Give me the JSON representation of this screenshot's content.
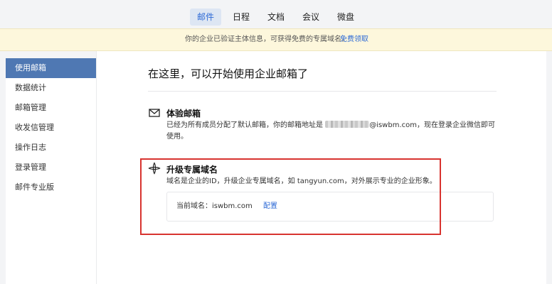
{
  "nav": {
    "tabs": [
      {
        "label": "邮件",
        "active": true
      },
      {
        "label": "日程"
      },
      {
        "label": "文档"
      },
      {
        "label": "会议"
      },
      {
        "label": "微盘"
      }
    ]
  },
  "banner": {
    "message": "你的企业已验证主体信息，可获得免费的专属域名。",
    "link": "免费领取"
  },
  "sidebar": {
    "items": [
      {
        "label": "使用邮箱",
        "active": true
      },
      {
        "label": "数据统计"
      },
      {
        "label": "邮箱管理"
      },
      {
        "label": "收发信管理"
      },
      {
        "label": "操作日志"
      },
      {
        "label": "登录管理"
      },
      {
        "label": "邮件专业版"
      }
    ]
  },
  "main": {
    "heading": "在这里，可以开始使用企业邮箱了",
    "trial": {
      "icon": "mail-icon",
      "title": "体验邮箱",
      "desc_before": "已经为所有成员分配了默认邮箱，你的邮箱地址是",
      "desc_domain": "@iswbm.com，现在登录企业微信即可",
      "desc_line2": "使用。"
    },
    "upgrade": {
      "icon": "domain-icon",
      "title": "升级专属域名",
      "desc": "域名是企业的ID，升级企业专属域名，如 tangyun.com，对外展示专业的企业形象。",
      "current_label": "当前域名：",
      "current_value": "iswbm.com",
      "config_link": "配置"
    }
  },
  "colors": {
    "accent": "#2d6ad6",
    "sidebar_active": "#4f78b3",
    "highlight_frame": "#d8332f",
    "banner_bg": "#fdf7dc"
  }
}
